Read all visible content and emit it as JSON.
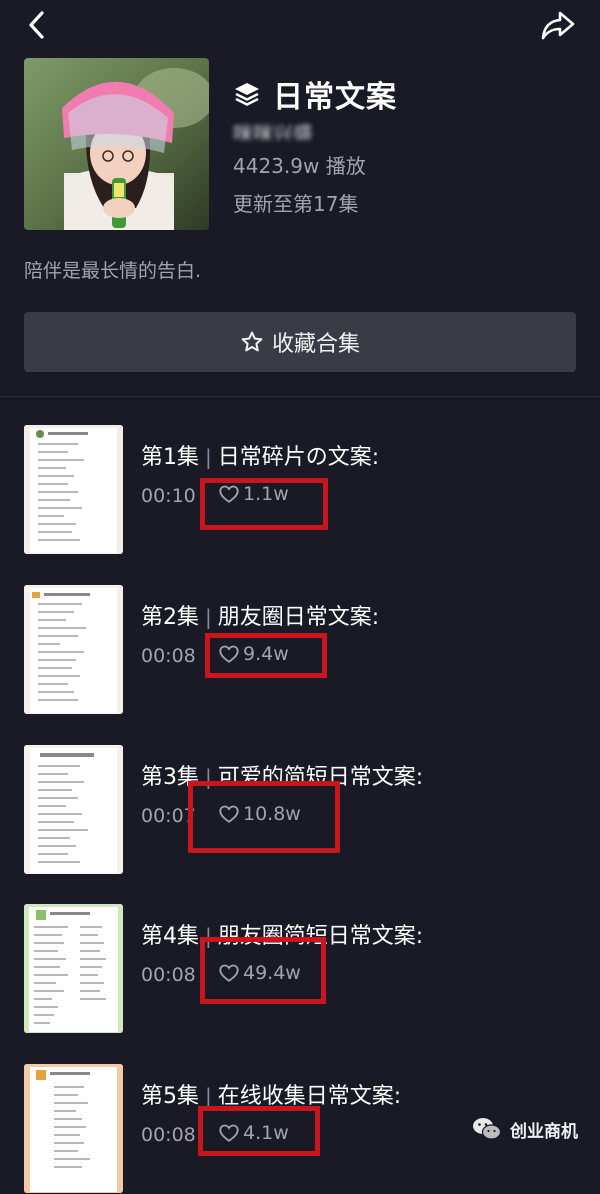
{
  "header": {
    "back_icon": "chevron-left-icon",
    "share_icon": "share-arrow-icon"
  },
  "series": {
    "title": "日常文案",
    "title_icon": "layers-icon",
    "author": "咪咪兴盛",
    "plays": "4423.9w 播放",
    "update": "更新至第17集",
    "description": "陪伴是最长情的告白.",
    "collect_label": "收藏合集",
    "collect_icon": "star-outline-icon"
  },
  "episodes": [
    {
      "ep": "第1集",
      "name": "日常碎片の文案:",
      "duration": "00:10",
      "likes": "1.1w",
      "thumb_color": "#f4ece8"
    },
    {
      "ep": "第2集",
      "name": "朋友圈日常文案:",
      "duration": "00:08",
      "likes": "9.4w",
      "thumb_color": "#f7efe9"
    },
    {
      "ep": "第3集",
      "name": "可爱的简短日常文案:",
      "duration": "00:07",
      "likes": "10.8w",
      "thumb_color": "#f8f0ea"
    },
    {
      "ep": "第4集",
      "name": "朋友圈简短日常文案:",
      "duration": "00:08",
      "likes": "49.4w",
      "thumb_color": "#cfe8bd"
    },
    {
      "ep": "第5集",
      "name": "在线收集日常文案:",
      "duration": "00:08",
      "likes": "4.1w",
      "thumb_color": "#f3c9a6"
    }
  ],
  "watermark": {
    "text": "创业商机",
    "icon": "wechat-icon"
  },
  "colors": {
    "background": "#1a1a26",
    "highlight": "#c8161c",
    "button_bg": "#3b3b46"
  }
}
